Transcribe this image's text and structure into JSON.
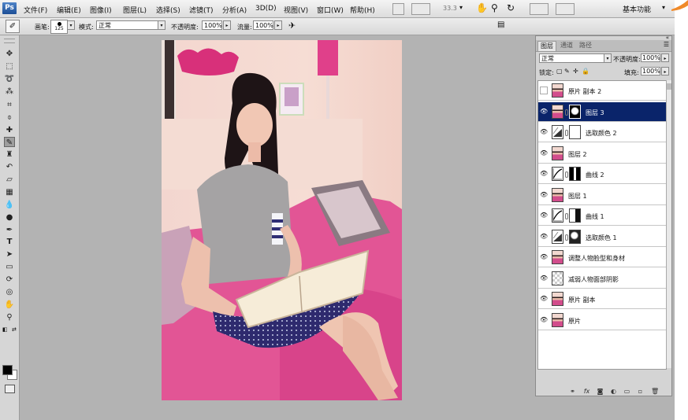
{
  "app": {
    "logo": "Ps",
    "menu": [
      "文件(F)",
      "编辑(E)",
      "图像(I)",
      "图层(L)",
      "选择(S)",
      "滤镜(T)",
      "分析(A)",
      "3D(D)",
      "视图(V)",
      "窗口(W)",
      "帮助(H)"
    ],
    "zoom": "33.3",
    "workspace": "基本功能"
  },
  "options_bar": {
    "brush_label": "画笔:",
    "brush_size": "125",
    "mode_label": "模式:",
    "mode_value": "正常",
    "opacity_label": "不透明度:",
    "opacity_value": "100%",
    "flow_label": "流量:",
    "flow_value": "100%"
  },
  "toolbox": {
    "tools": [
      "move",
      "marquee",
      "lasso",
      "quick-select",
      "crop",
      "eyedropper",
      "healing",
      "brush",
      "clone-stamp",
      "history-brush",
      "eraser",
      "gradient",
      "blur",
      "dodge",
      "pen",
      "type",
      "path-select",
      "shape",
      "3d-rotate",
      "3d-orbit",
      "hand",
      "zoom"
    ],
    "active_tool": "brush",
    "foreground_color": "#000000",
    "background_color": "#ffffff"
  },
  "layers_panel": {
    "tabs": [
      "图层",
      "通道",
      "路径"
    ],
    "active_tab": "图层",
    "blend_mode": "正常",
    "opacity_label": "不透明度:",
    "opacity_value": "100%",
    "lock_label": "锁定:",
    "fill_label": "填充:",
    "fill_value": "100%",
    "layers": [
      {
        "name": "原片 副本 2",
        "visible": false,
        "thumb": "photo",
        "mask": null,
        "selected": false
      },
      {
        "name": "图层 3",
        "visible": true,
        "thumb": "photo",
        "mask": "brush-mask",
        "selected": true
      },
      {
        "name": "选取颜色 2",
        "visible": true,
        "thumb": "selective-color",
        "mask": "white",
        "selected": false
      },
      {
        "name": "图层 2",
        "visible": true,
        "thumb": "photo",
        "mask": null,
        "selected": false
      },
      {
        "name": "曲线 2",
        "visible": true,
        "thumb": "curves",
        "mask": "black-white",
        "selected": false
      },
      {
        "name": "图层 1",
        "visible": true,
        "thumb": "photo",
        "mask": null,
        "selected": false
      },
      {
        "name": "曲线 1",
        "visible": true,
        "thumb": "curves",
        "mask": "white-dark",
        "selected": false
      },
      {
        "name": "选取颜色 1",
        "visible": true,
        "thumb": "selective-color",
        "mask": "dark-white",
        "selected": false
      },
      {
        "name": "调整人物脸型和身材",
        "visible": true,
        "thumb": "photo",
        "mask": null,
        "selected": false
      },
      {
        "name": "减弱人物面部阴影",
        "visible": true,
        "thumb": "transparent",
        "mask": null,
        "selected": false
      },
      {
        "name": "原片 副本",
        "visible": true,
        "thumb": "photo",
        "mask": null,
        "selected": false
      },
      {
        "name": "原片",
        "visible": true,
        "thumb": "photo",
        "mask": null,
        "selected": false
      }
    ],
    "footer_icons": [
      "link-icon",
      "fx-icon",
      "add-mask-icon",
      "adjustment-icon",
      "group-icon",
      "new-layer-icon",
      "trash-icon"
    ]
  }
}
